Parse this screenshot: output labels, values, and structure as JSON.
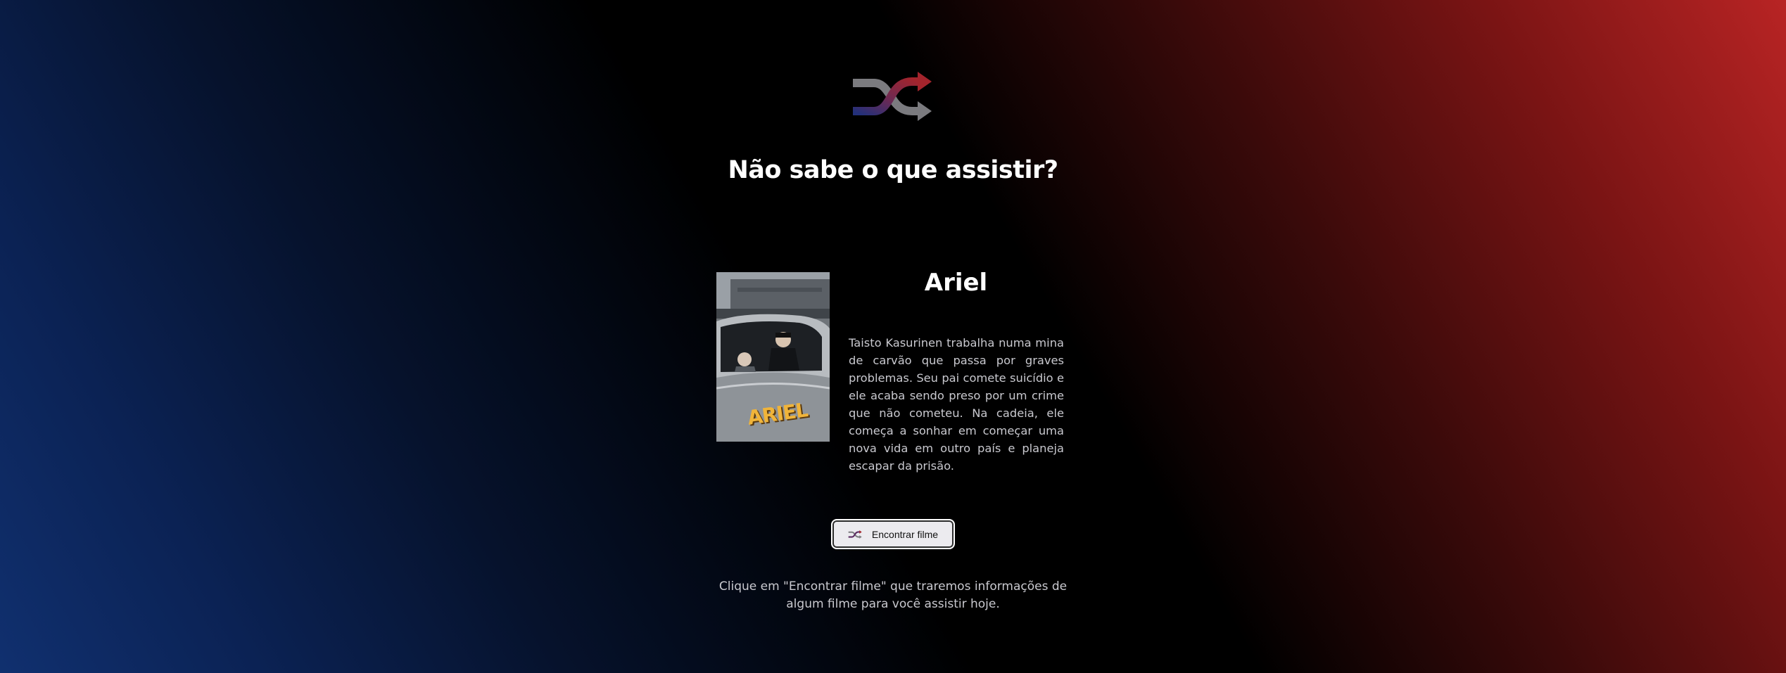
{
  "header": {
    "logo_icon": "shuffle-icon",
    "title": "Não sabe o que assistir?"
  },
  "movie": {
    "poster_text": "ARIEL",
    "title": "Ariel",
    "overview": "Taisto Kasurinen trabalha numa mina de carvão que passa por graves problemas. Seu pai comete suicídio e ele acaba sendo preso por um crime que não cometeu. Na cadeia, ele começa a sonhar em começar uma nova vida em outro país e planeja escapar da prisão."
  },
  "action": {
    "button_icon": "shuffle-icon",
    "button_label": "Encontrar filme"
  },
  "footer": {
    "hint": "Clique em \"Encontrar filme\" que traremos informações de algum filme para você assistir hoje."
  },
  "colors": {
    "gradient_left": "#10306f",
    "gradient_center": "#000000",
    "gradient_right": "#b82424",
    "icon_red": "#a3242c",
    "icon_blue": "#2c2e78",
    "icon_gray": "#7b7b7f"
  }
}
